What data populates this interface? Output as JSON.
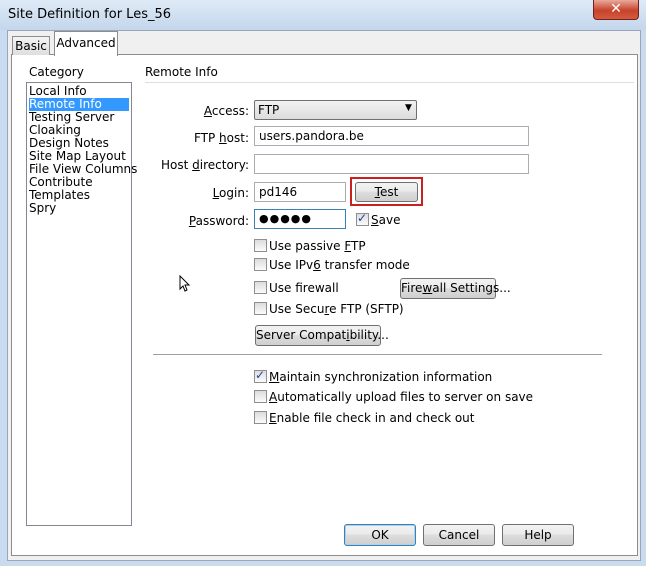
{
  "window": {
    "title": "Site Definition for Les_56",
    "close_glyph": "✕"
  },
  "tabs": [
    {
      "label": "Basic",
      "active": false
    },
    {
      "label": "Advanced",
      "active": true
    }
  ],
  "category": {
    "heading": "Category",
    "items": [
      "Local Info",
      "Remote Info",
      "Testing Server",
      "Cloaking",
      "Design Notes",
      "Site Map Layout",
      "File View Columns",
      "Contribute",
      "Templates",
      "Spry"
    ],
    "selected": "Remote Info"
  },
  "remote": {
    "heading": "Remote Info",
    "access": {
      "label_pre": "",
      "label_u": "A",
      "label_post": "ccess:",
      "value": "FTP"
    },
    "ftp_host": {
      "label_pre": "FTP ",
      "label_u": "h",
      "label_post": "ost:",
      "value": "users.pandora.be"
    },
    "host_dir": {
      "label_pre": "Host ",
      "label_u": "d",
      "label_post": "irectory:",
      "value": ""
    },
    "login": {
      "label_pre": "",
      "label_u": "L",
      "label_post": "ogin:",
      "value": "pd146"
    },
    "password": {
      "label_pre": "",
      "label_u": "P",
      "label_post": "assword:",
      "value": "●●●●●"
    },
    "test_button": {
      "pre": "",
      "u": "T",
      "post": "est"
    },
    "save_checkbox": {
      "pre": "",
      "u": "S",
      "post": "ave",
      "checked": true
    },
    "passive_ftp": {
      "pre": "Use passive ",
      "u": "F",
      "post": "TP",
      "checked": false
    },
    "ipv6": {
      "pre": "Use IPv",
      "u": "6",
      "post": " transfer mode",
      "checked": false
    },
    "firewall": {
      "pre": "Use f",
      "u": "i",
      "post": "rewall",
      "checked": false
    },
    "firewall_settings": {
      "pre": "Fire",
      "u": "w",
      "post": "all Settings..."
    },
    "sftp": {
      "pre": "Use Secu",
      "u": "r",
      "post": "e FTP (SFTP)",
      "checked": false
    },
    "server_compat": {
      "pre": "Server Compat",
      "u": "i",
      "post": "bility..."
    },
    "maintain_sync": {
      "pre": "",
      "u": "M",
      "post": "aintain synchronization information",
      "checked": true
    },
    "auto_upload": {
      "pre": "",
      "u": "A",
      "post": "utomatically upload files to server on save",
      "checked": false
    },
    "check_in_out": {
      "pre": "",
      "u": "E",
      "post": "nable file check in and check out",
      "checked": false
    }
  },
  "footer": {
    "ok": "OK",
    "cancel": "Cancel",
    "help": "Help"
  },
  "colors": {
    "highlight_box": "#cc1f1f",
    "selection": "#3399ff",
    "default_button_border": "#3c7fb1"
  }
}
